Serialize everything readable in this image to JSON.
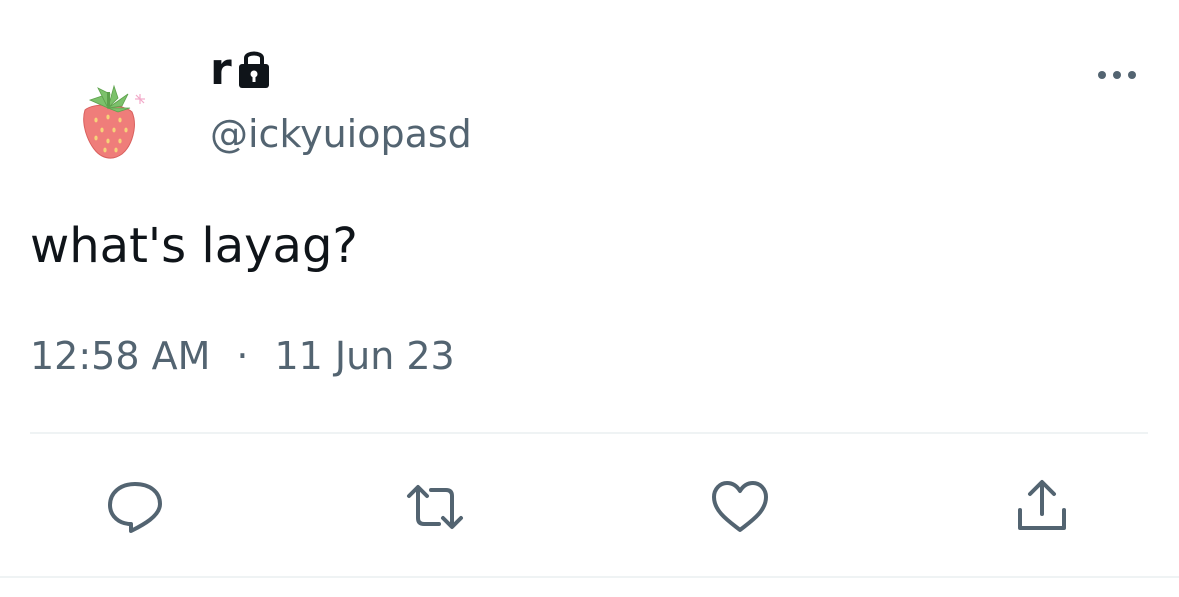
{
  "user": {
    "display_name": "r",
    "handle": "@ickyuiopasd",
    "avatar_icon": "strawberry-avatar",
    "protected_icon": "lock-icon"
  },
  "tweet": {
    "text": "what's layag?",
    "time": "12:58 AM",
    "separator": "·",
    "date": "11 Jun 23"
  },
  "actions": {
    "reply_icon": "reply-icon",
    "retweet_icon": "retweet-icon",
    "like_icon": "heart-icon",
    "share_icon": "share-icon",
    "more_icon": "more-icon"
  },
  "colors": {
    "text_primary": "#0f1419",
    "text_secondary": "#536471",
    "divider": "#eff3f4"
  }
}
